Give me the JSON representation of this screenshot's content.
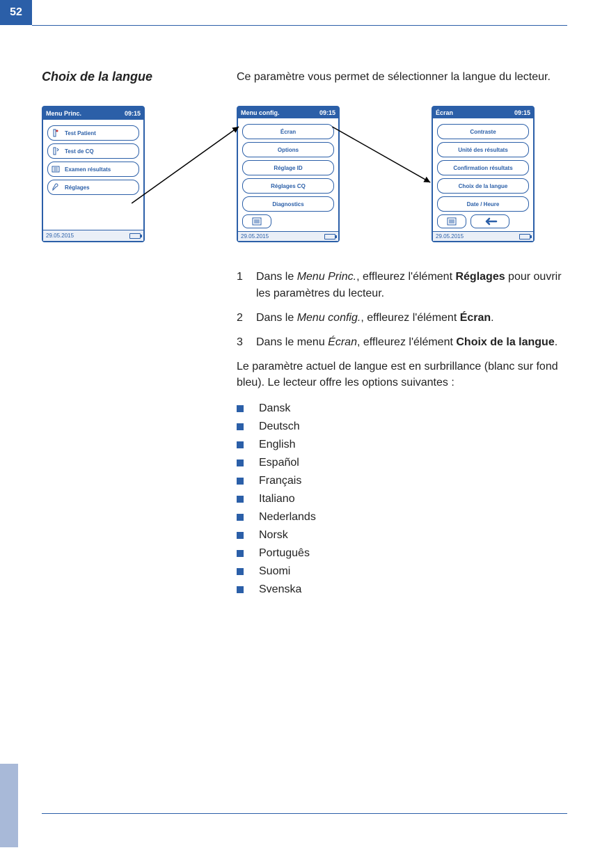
{
  "page_number": "52",
  "section_title": "Choix de la langue",
  "intro_text": "Ce paramètre vous permet de sélectionner la langue du lecteur.",
  "screens": {
    "s1": {
      "title": "Menu Princ.",
      "time": "09:15",
      "items": [
        "Test Patient",
        "Test de CQ",
        "Examen résultats",
        "Réglages"
      ],
      "date": "29.05.2015"
    },
    "s2": {
      "title": "Menu config.",
      "time": "09:15",
      "items": [
        "Écran",
        "Options",
        "Réglage ID",
        "Réglages CQ",
        "Diagnostics"
      ],
      "date": "29.05.2015"
    },
    "s3": {
      "title": "Écran",
      "time": "09:15",
      "items": [
        "Contraste",
        "Unité des résultats",
        "Confirmation résultats",
        "Choix de la langue",
        "Date / Heure"
      ],
      "date": "29.05.2015"
    }
  },
  "steps": {
    "n1": "1",
    "t1a": "Dans le ",
    "t1b": "Menu Princ.",
    "t1c": ", effleurez l'élément ",
    "t1d": "Réglages",
    "t1e": " pour ouvrir les paramètres du lecteur.",
    "n2": "2",
    "t2a": "Dans le ",
    "t2b": "Menu config.",
    "t2c": ", effleurez l'élément ",
    "t2d": "Écran",
    "t2e": ".",
    "n3": "3",
    "t3a": "Dans le menu ",
    "t3b": "Écran",
    "t3c": ", effleurez l'élément ",
    "t3d": "Choix de la langue",
    "t3e": "."
  },
  "para_text": "Le paramètre actuel de langue est en surbrillance (blanc sur fond bleu). Le lecteur offre les options suivantes :",
  "languages": [
    "Dansk",
    "Deutsch",
    "English",
    "Español",
    "Français",
    "Italiano",
    "Nederlands",
    "Norsk",
    "Português",
    "Suomi",
    "Svenska"
  ]
}
